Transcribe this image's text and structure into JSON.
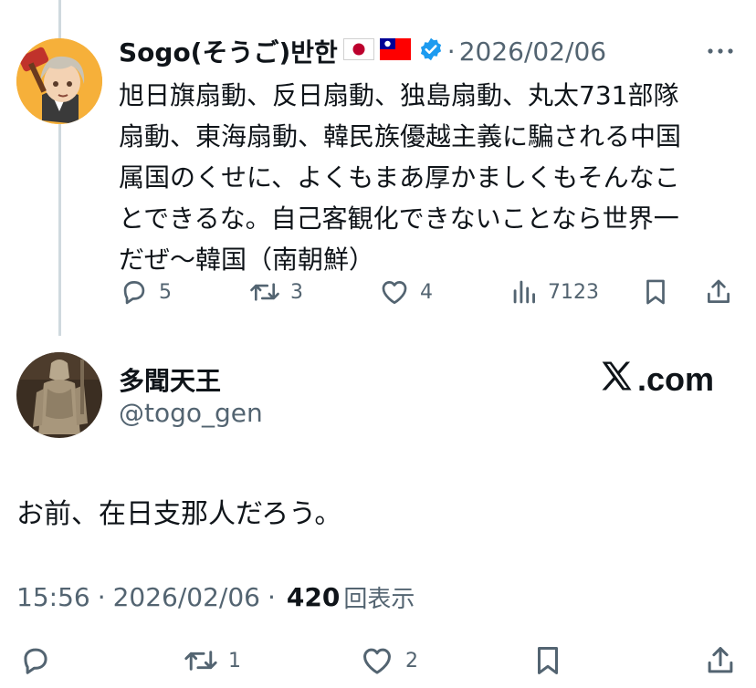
{
  "top_tweet": {
    "display_name": "Sogo(そうご)반한",
    "flags": [
      "japan-flag",
      "taiwan-flag"
    ],
    "verified": true,
    "separator": "·",
    "date": "2026/02/06",
    "text": "旭日旗扇動、反日扇動、独島扇動、丸太731部隊\n扇動、東海扇動、韓民族優越主義に騙される中国\n属国のくせに、よくもまあ厚かましくもそんなこ\nとできるな。自己客観化できないことなら世界一\nだぜ〜韓国（南朝鮮）",
    "actions": {
      "replies": "5",
      "reposts": "3",
      "likes": "4",
      "views": "7123"
    }
  },
  "reply_tweet": {
    "display_name": "多聞天王",
    "handle": "@togo_gen",
    "watermark": ".com",
    "text": "お前、在日支那人だろう。",
    "time": "15:56",
    "separator": "·",
    "date": "2026/02/06",
    "separator2": "·",
    "views_count": "420",
    "views_label": "回表示",
    "actions": {
      "reposts": "1",
      "likes": "2"
    }
  },
  "colors": {
    "text": "#0f1419",
    "secondary": "#536471",
    "verified_blue": "#1d9bf0",
    "thread_line": "#cfd9de"
  }
}
